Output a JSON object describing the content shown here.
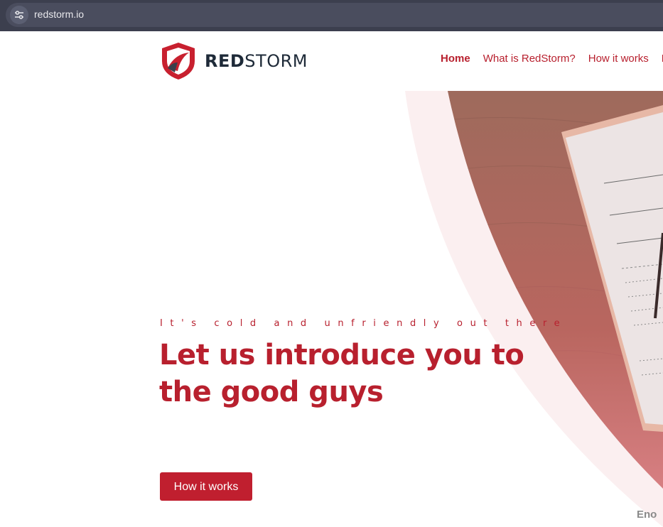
{
  "browser": {
    "url": "redstorm.io",
    "site_info_icon": "tune-icon"
  },
  "logo": {
    "text_bold": "RED",
    "text_light": "STORM",
    "icon": "shield-icon",
    "colors": {
      "shield": "#c8202f",
      "dark": "#1e2a38"
    }
  },
  "nav": {
    "items": [
      {
        "label": "Home",
        "active": true
      },
      {
        "label": "What is RedStorm?"
      },
      {
        "label": "How it works"
      },
      {
        "label": "F"
      }
    ]
  },
  "hero": {
    "eyebrow": "It's cold and unfriendly out there",
    "headline": "Let us introduce you to the good guys",
    "cta_label": "How it works"
  },
  "corner_text": "Eno",
  "colors": {
    "accent": "#b8202e",
    "button": "#c01f2f",
    "browser_bar": "#3c3f4e"
  }
}
